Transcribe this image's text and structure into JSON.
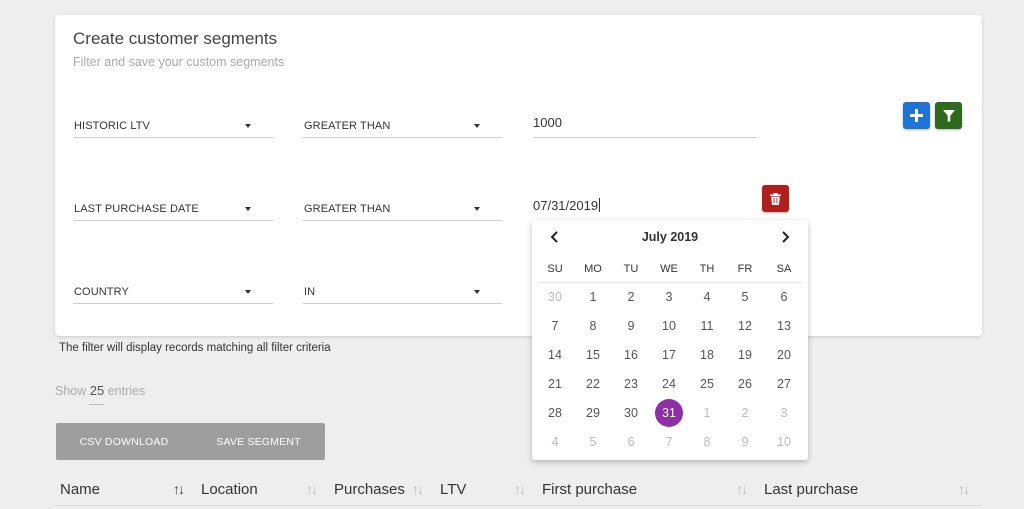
{
  "header": {
    "title": "Create customer segments",
    "subtitle": "Filter and save your custom segments"
  },
  "filters": [
    {
      "field": "HISTORIC LTV",
      "operator": "GREATER THAN",
      "value": "1000"
    },
    {
      "field": "LAST PURCHASE DATE",
      "operator": "GREATER THAN",
      "value": "07/31/2019"
    },
    {
      "field": "COUNTRY",
      "operator": "IN",
      "value": ""
    }
  ],
  "buttons": {
    "add_icon": "plus-icon",
    "filter_icon": "filter-icon",
    "delete_icon": "trash-icon",
    "add_color": "#1e73d4",
    "filter_color": "#2d6a1e",
    "delete_color": "#b01e1e"
  },
  "calendar": {
    "month_label": "July 2019",
    "weekdays": [
      "SU",
      "MO",
      "TU",
      "WE",
      "TH",
      "FR",
      "SA"
    ],
    "weeks": [
      [
        "30",
        "1",
        "2",
        "3",
        "4",
        "5",
        "6"
      ],
      [
        "7",
        "8",
        "9",
        "10",
        "11",
        "12",
        "13"
      ],
      [
        "14",
        "15",
        "16",
        "17",
        "18",
        "19",
        "20"
      ],
      [
        "21",
        "22",
        "23",
        "24",
        "25",
        "26",
        "27"
      ],
      [
        "28",
        "29",
        "30",
        "31",
        "1",
        "2",
        "3"
      ],
      [
        "4",
        "5",
        "6",
        "7",
        "8",
        "9",
        "10"
      ]
    ],
    "selected_day": "31",
    "selected_color": "#8e2fa8"
  },
  "note": "The filter will display records matching all filter criteria",
  "entries": {
    "prefix": "Show",
    "count": "25",
    "suffix": "entries"
  },
  "actions": {
    "csv": "CSV DOWNLOAD",
    "save": "SAVE SEGMENT"
  },
  "table": {
    "columns": [
      "Name",
      "Location",
      "Purchases",
      "LTV",
      "First purchase",
      "Last purchase"
    ]
  }
}
